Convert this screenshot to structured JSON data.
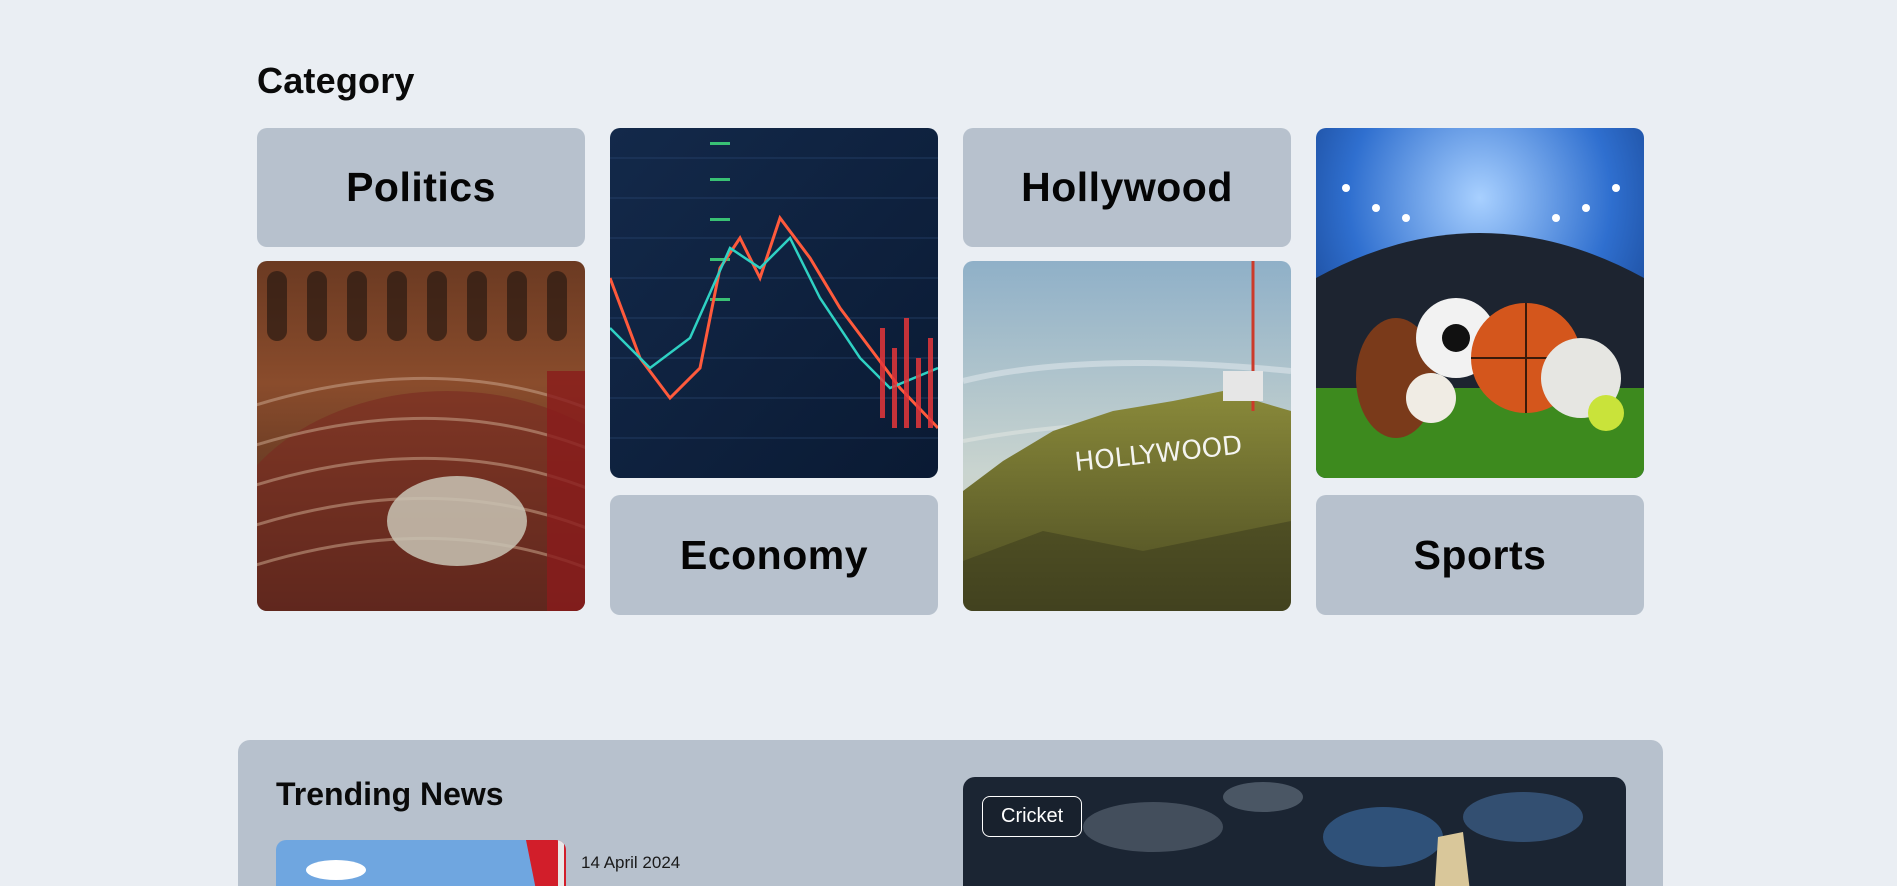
{
  "category": {
    "title": "Category",
    "items": [
      {
        "label": "Politics",
        "image": "parliament-chamber"
      },
      {
        "label": "Economy",
        "image": "stock-market-chart"
      },
      {
        "label": "Hollywood",
        "image": "hollywood-sign-hill"
      },
      {
        "label": "Sports",
        "image": "sports-balls-stadium"
      }
    ]
  },
  "trending": {
    "title": "Trending News",
    "first_item": {
      "date": "14 April 2024",
      "image": "city-flag"
    },
    "feature": {
      "tag": "Cricket",
      "image": "cricket-bat"
    }
  },
  "colors": {
    "page_bg": "#eaeef3",
    "tile_bg": "#b7c1cd",
    "text": "#050505"
  }
}
